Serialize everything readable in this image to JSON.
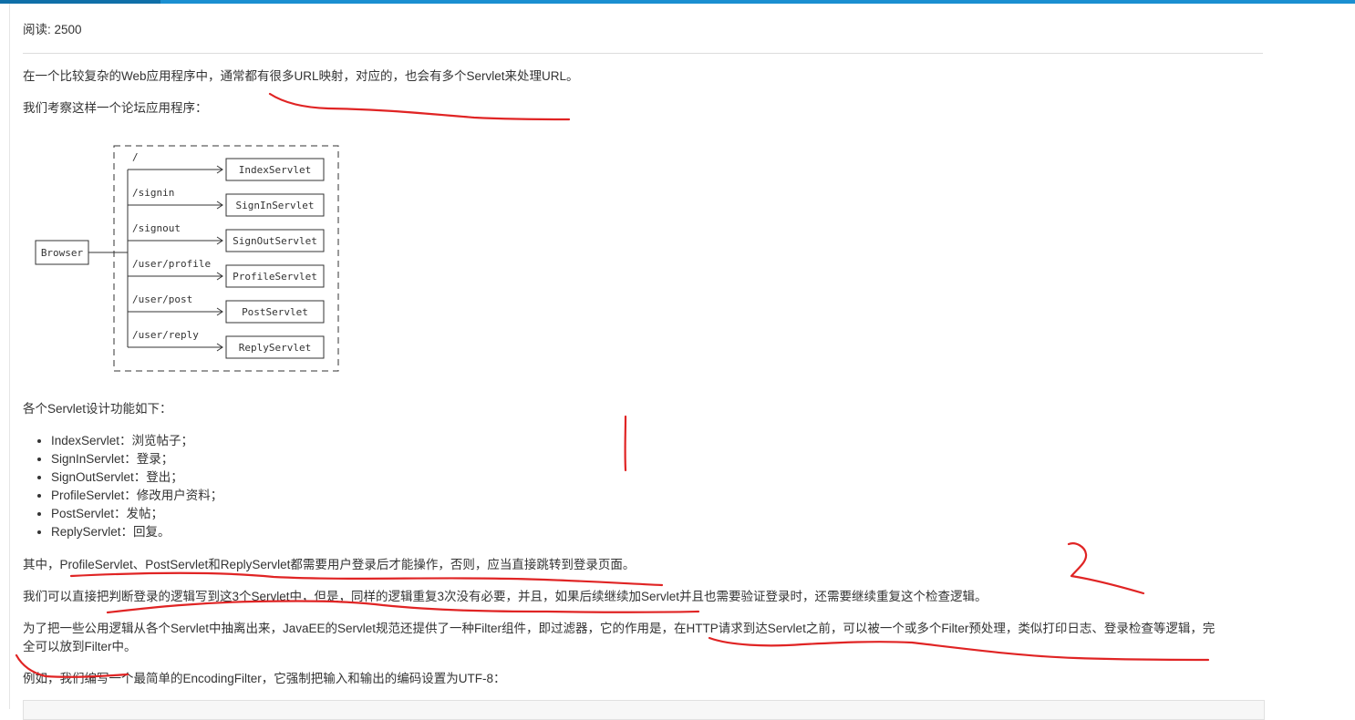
{
  "meta": {
    "read_label": "阅读: 2500"
  },
  "article": {
    "p1": "在一个比较复杂的Web应用程序中，通常都有很多URL映射，对应的，也会有多个Servlet来处理URL。",
    "p2": "我们考察这样一个论坛应用程序：",
    "diagram": {
      "browser": "Browser",
      "routes": [
        {
          "path": "/",
          "servlet": "IndexServlet"
        },
        {
          "path": "/signin",
          "servlet": "SignInServlet"
        },
        {
          "path": "/signout",
          "servlet": "SignOutServlet"
        },
        {
          "path": "/user/profile",
          "servlet": "ProfileServlet"
        },
        {
          "path": "/user/post",
          "servlet": "PostServlet"
        },
        {
          "path": "/user/reply",
          "servlet": "ReplyServlet"
        }
      ]
    },
    "p3": "各个Servlet设计功能如下：",
    "list": [
      "IndexServlet：浏览帖子；",
      "SignInServlet：登录；",
      "SignOutServlet：登出；",
      "ProfileServlet：修改用户资料；",
      "PostServlet：发帖；",
      "ReplyServlet：回复。"
    ],
    "p4": "其中，ProfileServlet、PostServlet和ReplyServlet都需要用户登录后才能操作，否则，应当直接跳转到登录页面。",
    "p5": "我们可以直接把判断登录的逻辑写到这3个Servlet中，但是，同样的逻辑重复3次没有必要，并且，如果后续继续加Servlet并且也需要验证登录时，还需要继续重复这个检查逻辑。",
    "p6_line1": "为了把一些公用逻辑从各个Servlet中抽离出来，JavaEE的Servlet规范还提供了一种Filter组件，即过滤器，它的作用是，在HTTP请求到达Servlet之前，可以被一个或多个Filter预处理，类似打印日志、登录检查等逻辑，完",
    "p6_line2": "全可以放到Filter中。",
    "p7": "例如，我们编写一个最简单的EncodingFilter，它强制把输入和输出的编码设置为UTF-8："
  },
  "colors": {
    "accent": "#1a8fd1",
    "annotation": "#e02424"
  }
}
